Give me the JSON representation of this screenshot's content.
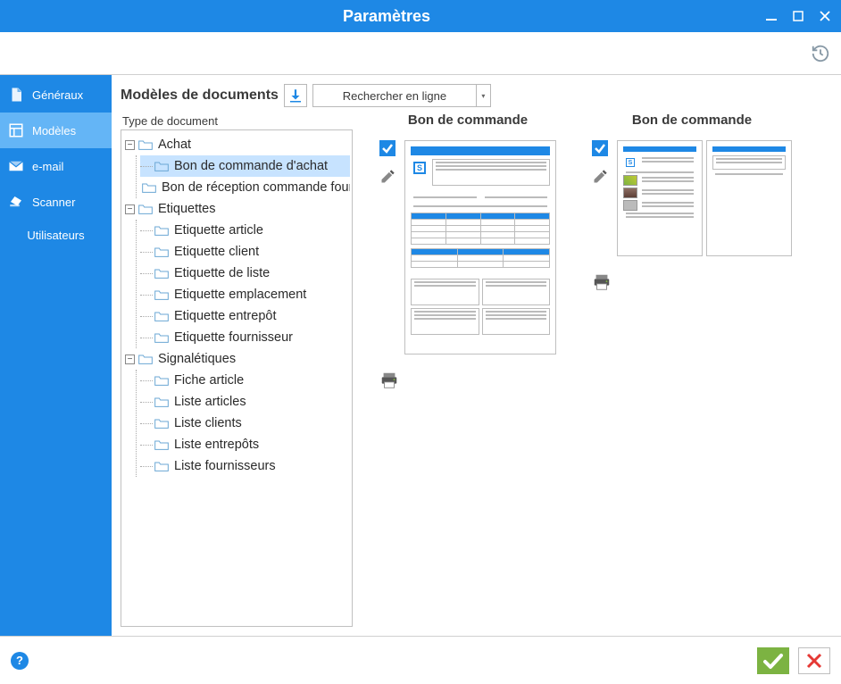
{
  "window": {
    "title": "Paramètres"
  },
  "sidebar": {
    "items": [
      {
        "label": "Généraux"
      },
      {
        "label": "Modèles"
      },
      {
        "label": "e-mail"
      },
      {
        "label": "Scanner"
      },
      {
        "label": "Utilisateurs"
      }
    ]
  },
  "main": {
    "heading": "Modèles de documents",
    "search_label": "Rechercher en ligne",
    "tree_title": "Type de document",
    "tree": {
      "achat": {
        "label": "Achat",
        "children": [
          "Bon de commande d'achat",
          "Bon de réception commande fournisseur"
        ]
      },
      "etiquettes": {
        "label": "Etiquettes",
        "children": [
          "Etiquette article",
          "Etiquette client",
          "Etiquette de liste",
          "Etiquette emplacement",
          "Etiquette entrepôt",
          "Etiquette fournisseur"
        ]
      },
      "signaletiques": {
        "label": "Signalétiques",
        "children": [
          "Fiche article",
          "Liste articles",
          "Liste clients",
          "Liste entrepôts",
          "Liste fournisseurs"
        ]
      }
    },
    "previews": [
      {
        "title": "Bon de commande"
      },
      {
        "title": "Bon de commande"
      }
    ]
  }
}
